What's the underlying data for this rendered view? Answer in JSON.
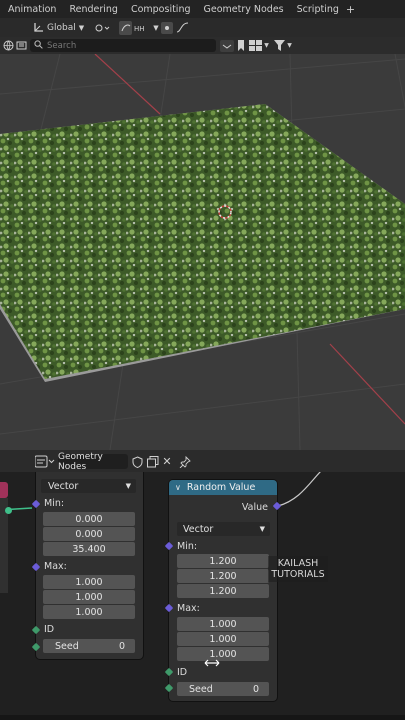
{
  "tabs": [
    "Animation",
    "Rendering",
    "Compositing",
    "Geometry Nodes",
    "Scripting"
  ],
  "tab_plus": "+",
  "viewport_header": {
    "orientation": "Global",
    "search_placeholder": "Search"
  },
  "node_editor_header": {
    "editor_name": "Geometry Nodes"
  },
  "left_node": {
    "mode": "Vector",
    "min_label": "Min:",
    "min_values": [
      "0.000",
      "0.000",
      "35.400"
    ],
    "max_label": "Max:",
    "max_values": [
      "1.000",
      "1.000",
      "1.000"
    ],
    "id_label": "ID",
    "seed_label": "Seed",
    "seed_value": "0"
  },
  "random_value_node": {
    "title": "Random Value",
    "output_label": "Value",
    "mode": "Vector",
    "min_label": "Min:",
    "min_values": [
      "1.200",
      "1.200",
      "1.200"
    ],
    "max_label": "Max:",
    "max_values": [
      "1.000",
      "1.000",
      "1.000"
    ],
    "id_label": "ID",
    "seed_label": "Seed",
    "seed_value": "0"
  },
  "watermark": {
    "line1": "KAILASH",
    "line2": "TUTORIALS"
  },
  "colors": {
    "node_header": "#2f6a85",
    "vector_socket": "#6b5cd8",
    "int_socket": "#3f9a6a",
    "grass_dark": "#2f4420",
    "grass_light": "#7fa352",
    "ground": "#9a9a9a"
  }
}
